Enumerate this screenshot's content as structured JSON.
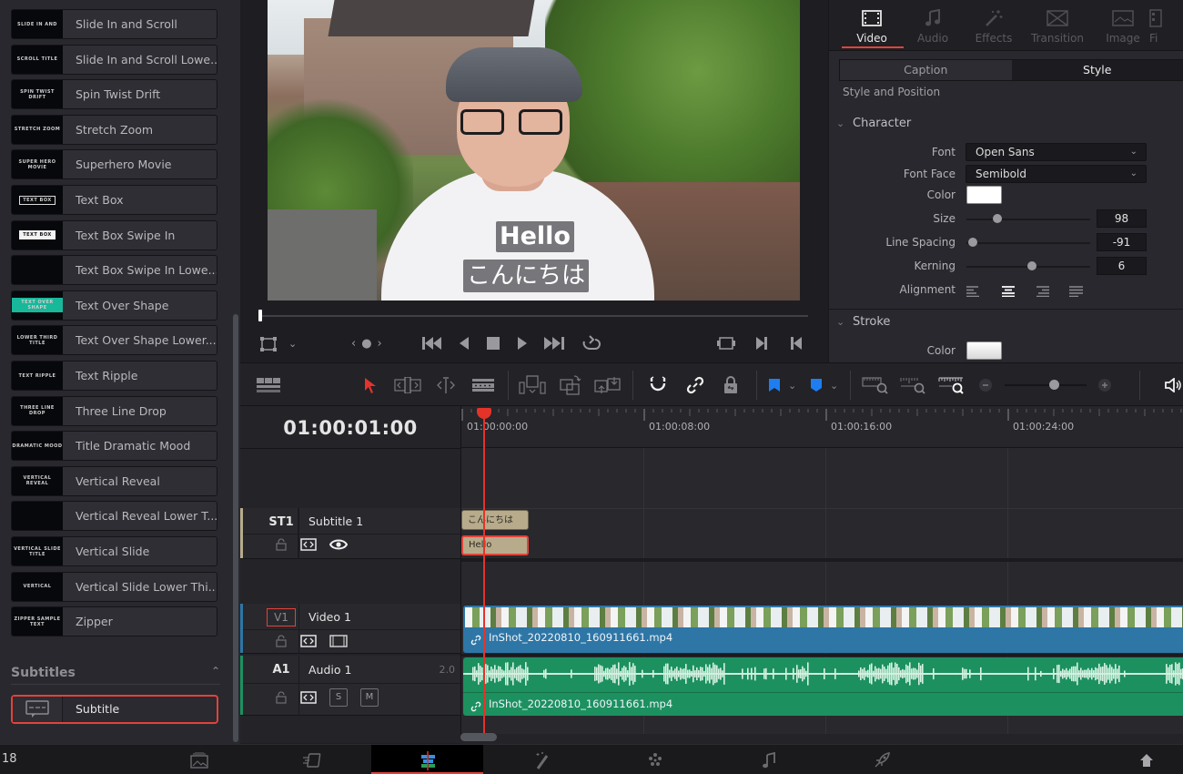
{
  "effects_list": {
    "items": [
      {
        "label": "Slide In and Scroll",
        "thumb_text": "SLIDE IN AND"
      },
      {
        "label": "Slide In and Scroll Lowe...",
        "thumb_text": "SCROLL TITLE"
      },
      {
        "label": "Spin Twist Drift",
        "thumb_text": "SPIN TWIST DRIFT"
      },
      {
        "label": "Stretch Zoom",
        "thumb_text": "STRETCH ZOOM"
      },
      {
        "label": "Superhero Movie",
        "thumb_text": "SUPER HERO MOVIE"
      },
      {
        "label": "Text Box",
        "thumb_text": "TEXT BOX"
      },
      {
        "label": "Text Box Swipe In",
        "thumb_text": "TEXT BOX"
      },
      {
        "label": "Text Box Swipe In Lowe...",
        "thumb_text": ""
      },
      {
        "label": "Text Over Shape",
        "thumb_text": "TEXT OVER SHAPE"
      },
      {
        "label": "Text Over Shape Lower...",
        "thumb_text": "LOWER THIRD TITLE"
      },
      {
        "label": "Text Ripple",
        "thumb_text": "TEXT RIPPLE"
      },
      {
        "label": "Three Line Drop",
        "thumb_text": "THREE LINE DROP"
      },
      {
        "label": "Title Dramatic Mood",
        "thumb_text": "DRAMATIC MOOD"
      },
      {
        "label": "Vertical Reveal",
        "thumb_text": "VERTICAL REVEAL"
      },
      {
        "label": "Vertical Reveal Lower T...",
        "thumb_text": ""
      },
      {
        "label": "Vertical Slide",
        "thumb_text": "VERTICAL SLIDE TITLE"
      },
      {
        "label": "Vertical Slide Lower Thi...",
        "thumb_text": "VERTICAL"
      },
      {
        "label": "Zipper",
        "thumb_text": "ZIPPER SAMPLE TEXT"
      }
    ],
    "subtitles_section": {
      "title": "Subtitles",
      "item_label": "Subtitle"
    }
  },
  "viewer": {
    "caption_line_1": "Hello",
    "caption_line_2": "こんにちは",
    "playback_position": 0.0
  },
  "inspector": {
    "tabs": [
      {
        "label": "Video",
        "icon": "film-icon",
        "active": true
      },
      {
        "label": "Audio",
        "icon": "music-note-icon",
        "active": false
      },
      {
        "label": "Effects",
        "icon": "magic-wand-icon",
        "active": false
      },
      {
        "label": "Transition",
        "icon": "transition-icon",
        "active": false
      },
      {
        "label": "Image",
        "icon": "image-icon",
        "active": false
      },
      {
        "label": "Fi",
        "icon": "file-icon",
        "active": false
      }
    ],
    "segments": [
      {
        "label": "Caption",
        "active": false
      },
      {
        "label": "Style",
        "active": true
      }
    ],
    "section_title": "Style and Position",
    "character": {
      "title": "Character",
      "font_label": "Font",
      "font_value": "Open Sans",
      "font_face_label": "Font Face",
      "font_face_value": "Semibold",
      "color_label": "Color",
      "color_value": "#ffffff",
      "size_label": "Size",
      "size_value": "98",
      "size_slider_fraction": 0.25,
      "line_spacing_label": "Line Spacing",
      "line_spacing_value": "-91",
      "line_spacing_slider_fraction": 0.05,
      "kerning_label": "Kerning",
      "kerning_value": "6",
      "kerning_slider_fraction": 0.53,
      "alignment_label": "Alignment",
      "alignment_selected": "center"
    },
    "stroke": {
      "title": "Stroke",
      "color_label": "Color",
      "color_value": "#f0f0f0"
    }
  },
  "timeline": {
    "timecode": "01:00:01:00",
    "ruler_labels": [
      "01:00:00:00",
      "01:00:08:00",
      "01:00:16:00",
      "01:00:24:00"
    ],
    "zoom_fraction": 0.6,
    "tracks": [
      {
        "id": "ST1",
        "name": "Subtitle 1",
        "color": "#b7ab8c",
        "clips": [
          {
            "text": "こんにちは"
          },
          {
            "text": "Hello",
            "selected": true
          }
        ]
      },
      {
        "id": "V1",
        "name": "Video 1",
        "color": "#2e76a6",
        "clip_file": "InShot_20220810_160911661.mp4"
      },
      {
        "id": "A1",
        "name": "Audio 1",
        "color": "#1d9060",
        "channel_format": "2.0",
        "clip_file": "InShot_20220810_160911661.mp4",
        "solo_label": "S",
        "mute_label": "M"
      }
    ]
  },
  "pagebar": {
    "number": "18",
    "pages": [
      "media",
      "cut",
      "edit",
      "fusion",
      "color",
      "fairlight",
      "deliver"
    ],
    "active_page": "edit",
    "home_icon": "home-icon"
  },
  "colors": {
    "accent": "#e2433a",
    "playhead": "#e5332a",
    "subtitle_clip": "#b7ab8c",
    "video_clip": "#2e76a6",
    "audio_clip": "#1d9060",
    "flag_blue": "#1e7ef0"
  }
}
